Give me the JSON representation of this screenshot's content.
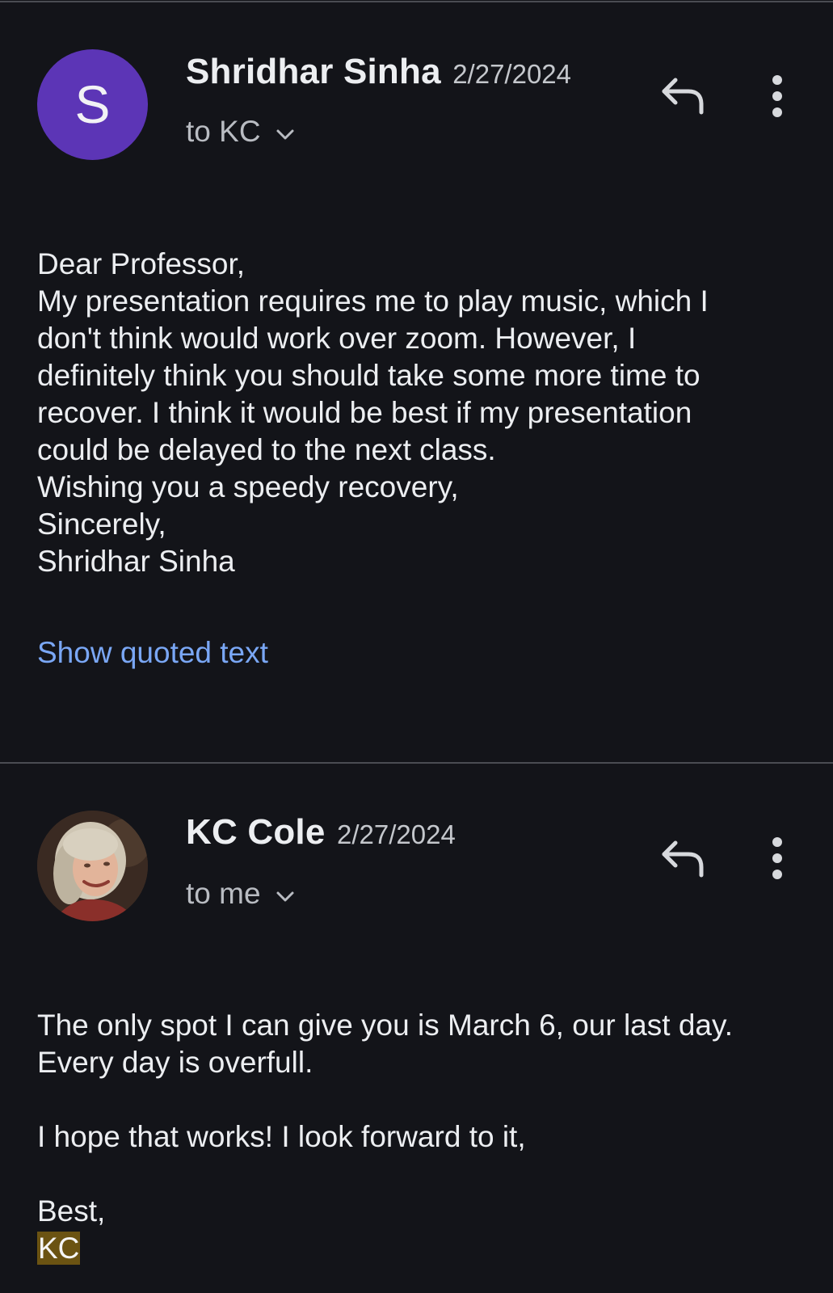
{
  "messages": [
    {
      "sender": "Shridhar Sinha",
      "date": "2/27/2024",
      "recipient": "to KC",
      "avatar_letter": "S",
      "avatar_color": "#5c35b6",
      "body_lines": [
        "Dear Professor,",
        "My presentation requires me to play music, which I",
        "don't think would work over zoom. However, I",
        "definitely think you should take some more time to",
        "recover. I think it would be best if my presentation",
        "could be delayed to the next class.",
        "Wishing you a speedy recovery,",
        "Sincerely,",
        "Shridhar Sinha"
      ],
      "show_quoted_label": "Show quoted text"
    },
    {
      "sender": "KC Cole",
      "date": "2/27/2024",
      "recipient": "to me",
      "avatar": "profile-photo",
      "body_lines": [
        "The only spot I can give you is March 6, our last day.",
        "Every day is overfull.",
        "",
        "I hope that works! I look forward to it,",
        "",
        "Best,"
      ],
      "signature": "KC"
    }
  ],
  "icons": {
    "reply": "reply-icon",
    "more": "more-vert-icon",
    "expand": "chevron-down-icon"
  },
  "colors": {
    "background": "#131419",
    "link": "#7aa7f5",
    "highlight": "#6b5312"
  }
}
